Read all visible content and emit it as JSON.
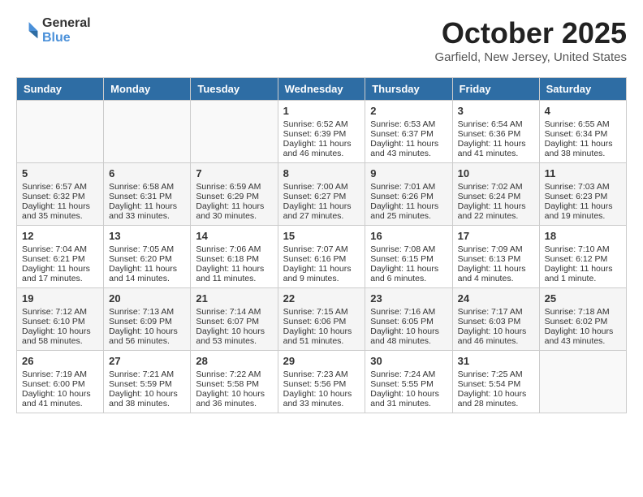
{
  "header": {
    "logo_general": "General",
    "logo_blue": "Blue",
    "month": "October 2025",
    "location": "Garfield, New Jersey, United States"
  },
  "weekdays": [
    "Sunday",
    "Monday",
    "Tuesday",
    "Wednesday",
    "Thursday",
    "Friday",
    "Saturday"
  ],
  "weeks": [
    [
      {
        "day": "",
        "info": ""
      },
      {
        "day": "",
        "info": ""
      },
      {
        "day": "",
        "info": ""
      },
      {
        "day": "1",
        "info": "Sunrise: 6:52 AM\nSunset: 6:39 PM\nDaylight: 11 hours and 46 minutes."
      },
      {
        "day": "2",
        "info": "Sunrise: 6:53 AM\nSunset: 6:37 PM\nDaylight: 11 hours and 43 minutes."
      },
      {
        "day": "3",
        "info": "Sunrise: 6:54 AM\nSunset: 6:36 PM\nDaylight: 11 hours and 41 minutes."
      },
      {
        "day": "4",
        "info": "Sunrise: 6:55 AM\nSunset: 6:34 PM\nDaylight: 11 hours and 38 minutes."
      }
    ],
    [
      {
        "day": "5",
        "info": "Sunrise: 6:57 AM\nSunset: 6:32 PM\nDaylight: 11 hours and 35 minutes."
      },
      {
        "day": "6",
        "info": "Sunrise: 6:58 AM\nSunset: 6:31 PM\nDaylight: 11 hours and 33 minutes."
      },
      {
        "day": "7",
        "info": "Sunrise: 6:59 AM\nSunset: 6:29 PM\nDaylight: 11 hours and 30 minutes."
      },
      {
        "day": "8",
        "info": "Sunrise: 7:00 AM\nSunset: 6:27 PM\nDaylight: 11 hours and 27 minutes."
      },
      {
        "day": "9",
        "info": "Sunrise: 7:01 AM\nSunset: 6:26 PM\nDaylight: 11 hours and 25 minutes."
      },
      {
        "day": "10",
        "info": "Sunrise: 7:02 AM\nSunset: 6:24 PM\nDaylight: 11 hours and 22 minutes."
      },
      {
        "day": "11",
        "info": "Sunrise: 7:03 AM\nSunset: 6:23 PM\nDaylight: 11 hours and 19 minutes."
      }
    ],
    [
      {
        "day": "12",
        "info": "Sunrise: 7:04 AM\nSunset: 6:21 PM\nDaylight: 11 hours and 17 minutes."
      },
      {
        "day": "13",
        "info": "Sunrise: 7:05 AM\nSunset: 6:20 PM\nDaylight: 11 hours and 14 minutes."
      },
      {
        "day": "14",
        "info": "Sunrise: 7:06 AM\nSunset: 6:18 PM\nDaylight: 11 hours and 11 minutes."
      },
      {
        "day": "15",
        "info": "Sunrise: 7:07 AM\nSunset: 6:16 PM\nDaylight: 11 hours and 9 minutes."
      },
      {
        "day": "16",
        "info": "Sunrise: 7:08 AM\nSunset: 6:15 PM\nDaylight: 11 hours and 6 minutes."
      },
      {
        "day": "17",
        "info": "Sunrise: 7:09 AM\nSunset: 6:13 PM\nDaylight: 11 hours and 4 minutes."
      },
      {
        "day": "18",
        "info": "Sunrise: 7:10 AM\nSunset: 6:12 PM\nDaylight: 11 hours and 1 minute."
      }
    ],
    [
      {
        "day": "19",
        "info": "Sunrise: 7:12 AM\nSunset: 6:10 PM\nDaylight: 10 hours and 58 minutes."
      },
      {
        "day": "20",
        "info": "Sunrise: 7:13 AM\nSunset: 6:09 PM\nDaylight: 10 hours and 56 minutes."
      },
      {
        "day": "21",
        "info": "Sunrise: 7:14 AM\nSunset: 6:07 PM\nDaylight: 10 hours and 53 minutes."
      },
      {
        "day": "22",
        "info": "Sunrise: 7:15 AM\nSunset: 6:06 PM\nDaylight: 10 hours and 51 minutes."
      },
      {
        "day": "23",
        "info": "Sunrise: 7:16 AM\nSunset: 6:05 PM\nDaylight: 10 hours and 48 minutes."
      },
      {
        "day": "24",
        "info": "Sunrise: 7:17 AM\nSunset: 6:03 PM\nDaylight: 10 hours and 46 minutes."
      },
      {
        "day": "25",
        "info": "Sunrise: 7:18 AM\nSunset: 6:02 PM\nDaylight: 10 hours and 43 minutes."
      }
    ],
    [
      {
        "day": "26",
        "info": "Sunrise: 7:19 AM\nSunset: 6:00 PM\nDaylight: 10 hours and 41 minutes."
      },
      {
        "day": "27",
        "info": "Sunrise: 7:21 AM\nSunset: 5:59 PM\nDaylight: 10 hours and 38 minutes."
      },
      {
        "day": "28",
        "info": "Sunrise: 7:22 AM\nSunset: 5:58 PM\nDaylight: 10 hours and 36 minutes."
      },
      {
        "day": "29",
        "info": "Sunrise: 7:23 AM\nSunset: 5:56 PM\nDaylight: 10 hours and 33 minutes."
      },
      {
        "day": "30",
        "info": "Sunrise: 7:24 AM\nSunset: 5:55 PM\nDaylight: 10 hours and 31 minutes."
      },
      {
        "day": "31",
        "info": "Sunrise: 7:25 AM\nSunset: 5:54 PM\nDaylight: 10 hours and 28 minutes."
      },
      {
        "day": "",
        "info": ""
      }
    ]
  ]
}
